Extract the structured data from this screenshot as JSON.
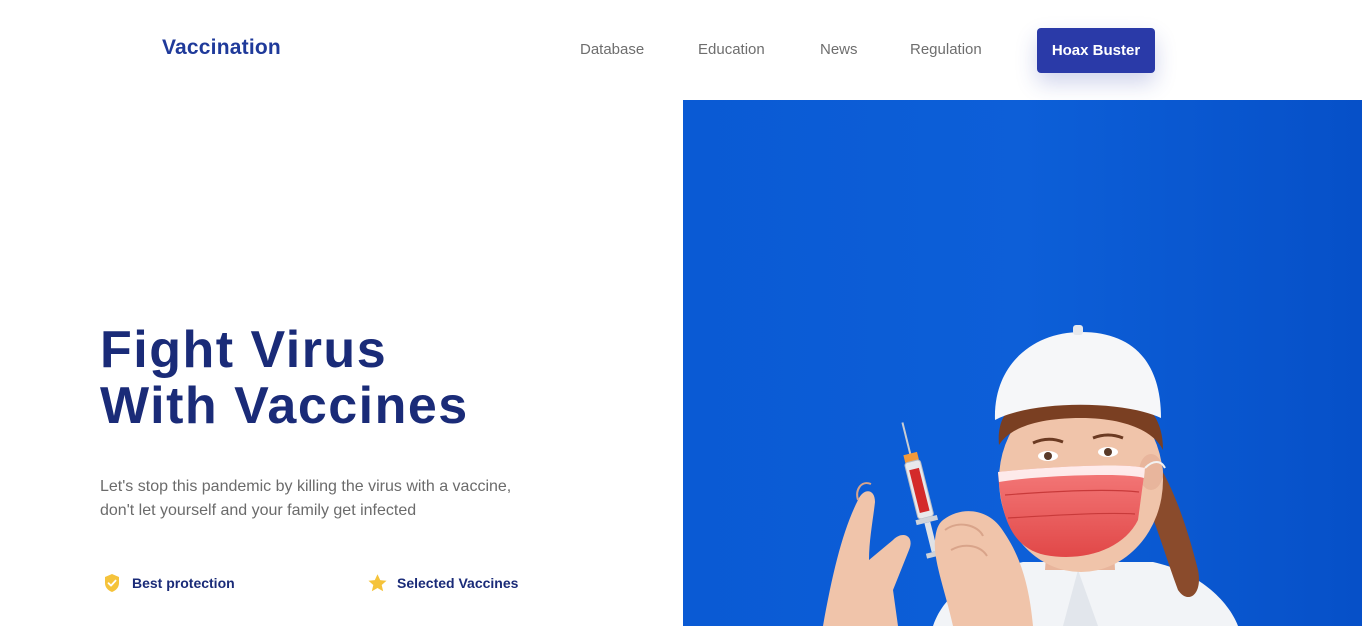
{
  "brand": {
    "name": "Vaccination"
  },
  "nav": {
    "items": [
      {
        "label": "Database"
      },
      {
        "label": "Education"
      },
      {
        "label": "News"
      },
      {
        "label": "Regulation"
      }
    ],
    "cta_label": "Hoax Buster"
  },
  "hero": {
    "title_line1": "Fight Virus",
    "title_line2": "With Vaccines",
    "description": "Let's stop this pandemic by killing the virus with a vaccine, don't let yourself and your family get infected",
    "features": [
      {
        "label": "Best protection",
        "icon": "shield-check-icon"
      },
      {
        "label": "Selected Vaccines",
        "icon": "star-icon"
      }
    ],
    "image": {
      "subject": "doctor-with-syringe-photo"
    }
  },
  "colors": {
    "brand": "#1f3a9a",
    "title": "#1a2b78",
    "button": "#2a3aa8",
    "hero_background": "#0756cc",
    "feature_icon": "#f5c33b"
  }
}
